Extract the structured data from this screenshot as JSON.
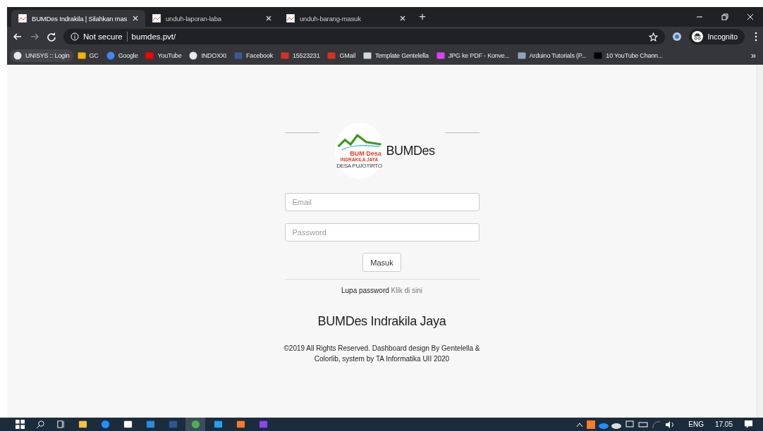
{
  "tabs": [
    {
      "title": "BUMDes Indrakila | Silahkan mas",
      "selected": true
    },
    {
      "title": "unduh-laporan-laba",
      "selected": false
    },
    {
      "title": "unduh-barang-masuk",
      "selected": false
    }
  ],
  "new_tab": "+",
  "address_bar": {
    "security": "Not secure",
    "url": "bumdes.pvt/"
  },
  "profile": "Incognito",
  "bookmarks": [
    {
      "label": "UNISYS :: Login",
      "kind": "globe"
    },
    {
      "label": "GC",
      "kind": "classroom"
    },
    {
      "label": "Google",
      "kind": "google"
    },
    {
      "label": "YouTube",
      "kind": "youtube"
    },
    {
      "label": "INDOXXI",
      "kind": "globe"
    },
    {
      "label": "Facebook",
      "kind": "facebook"
    },
    {
      "label": "15523231",
      "kind": "gmail"
    },
    {
      "label": "GMail",
      "kind": "gmail"
    },
    {
      "label": "Template Gentelella",
      "kind": "site"
    },
    {
      "label": "JPG ke PDF - Konve...",
      "kind": "grid"
    },
    {
      "label": "Arduino Tutorials (P...",
      "kind": "arduino"
    },
    {
      "label": "10 YouTube Chann...",
      "kind": "tw"
    }
  ],
  "bookmarks_more": "»",
  "login": {
    "logo": {
      "line_1": "BUM Desa",
      "line_2": "INDRAKILA JAYA",
      "line_3": "DESA PUJOTIRTO"
    },
    "brand": "BUMDes",
    "fields": [
      {
        "placeholder": "Email"
      },
      {
        "placeholder": "Password"
      }
    ],
    "submit": "Masuk",
    "forgot": "Lupa password",
    "forgot_link": "Klik di sini",
    "title": "BUMDes Indrakila Jaya",
    "footer": "©2019 All Rights Reserved. Dashboard design By Gentelella & Colorlib, system by TA Informatika UII 2020"
  },
  "taskbar": {
    "apps": [
      {
        "kind": "explorer",
        "active": false
      },
      {
        "kind": "edge",
        "active": false
      },
      {
        "kind": "store",
        "active": false
      },
      {
        "kind": "mail",
        "active": false
      },
      {
        "kind": "word",
        "active": false
      },
      {
        "kind": "chrome",
        "active": true
      },
      {
        "kind": "vscode",
        "active": false
      },
      {
        "kind": "xampp",
        "active": false
      },
      {
        "kind": "vs",
        "active": false
      }
    ],
    "language": "ENG",
    "time": "17.05"
  }
}
